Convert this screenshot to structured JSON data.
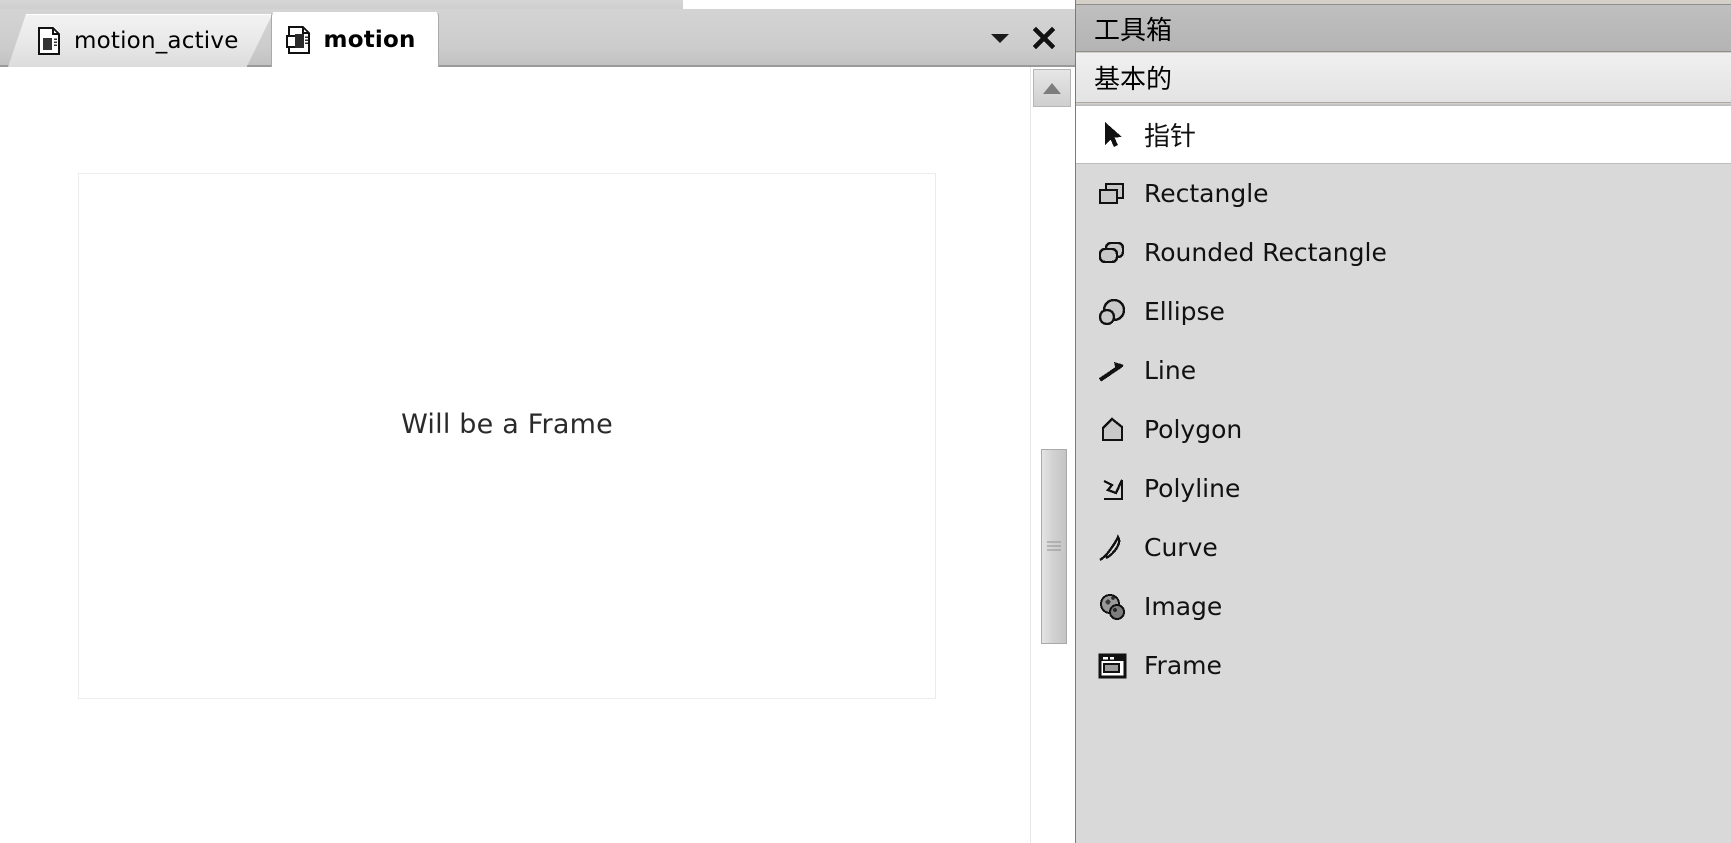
{
  "window": {
    "tabbar": {
      "tabs": [
        {
          "label": "motion_active",
          "icon": "document-icon",
          "active": false
        },
        {
          "label": "motion",
          "icon": "document-multi-icon",
          "active": true
        }
      ],
      "menu_button_icon": "chevron-down-icon",
      "close_button_label": "✕"
    },
    "editor": {
      "frame_label": "Will be a Frame",
      "scrollbar": {
        "up_arrow_icon": "chevron-up-icon",
        "thumb_grip_icon": "grip-lines-icon"
      }
    }
  },
  "toolbox": {
    "title": "工具箱",
    "section": "基本的",
    "tools": [
      {
        "label": "指针",
        "icon": "pointer-icon",
        "selected": true,
        "cjk": true
      },
      {
        "label": "Rectangle",
        "icon": "rectangle-icon",
        "selected": false,
        "cjk": false
      },
      {
        "label": "Rounded Rectangle",
        "icon": "rounded-rectangle-icon",
        "selected": false,
        "cjk": false
      },
      {
        "label": "Ellipse",
        "icon": "ellipse-icon",
        "selected": false,
        "cjk": false
      },
      {
        "label": "Line",
        "icon": "line-icon",
        "selected": false,
        "cjk": false
      },
      {
        "label": "Polygon",
        "icon": "polygon-icon",
        "selected": false,
        "cjk": false
      },
      {
        "label": "Polyline",
        "icon": "polyline-icon",
        "selected": false,
        "cjk": false
      },
      {
        "label": "Curve",
        "icon": "curve-icon",
        "selected": false,
        "cjk": false
      },
      {
        "label": "Image",
        "icon": "image-icon",
        "selected": false,
        "cjk": false
      },
      {
        "label": "Frame",
        "icon": "frame-icon",
        "selected": false,
        "cjk": false
      }
    ]
  },
  "colors": {
    "tabbar_bg": "#cccccc",
    "toolbox_title_bg": "#bfbfbf",
    "toolbox_list_bg": "#d9d9d9",
    "selection_bg": "#ffffff",
    "canvas_bg": "#ffffff"
  }
}
